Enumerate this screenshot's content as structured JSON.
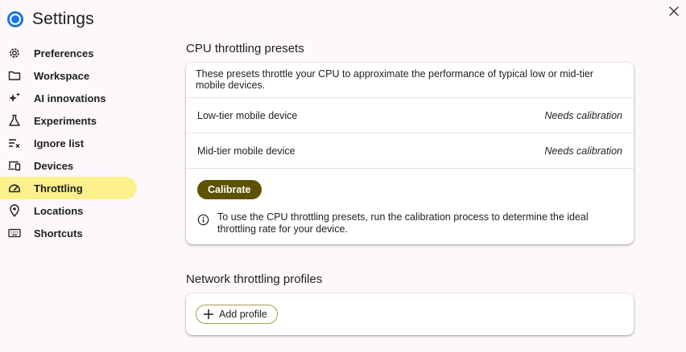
{
  "header": {
    "title": "Settings"
  },
  "sidebar": {
    "items": [
      {
        "label": "Preferences",
        "icon": "gear-icon"
      },
      {
        "label": "Workspace",
        "icon": "folder-icon"
      },
      {
        "label": "AI innovations",
        "icon": "sparkle-icon"
      },
      {
        "label": "Experiments",
        "icon": "flask-icon"
      },
      {
        "label": "Ignore list",
        "icon": "ignore-list-icon"
      },
      {
        "label": "Devices",
        "icon": "devices-icon"
      },
      {
        "label": "Throttling",
        "icon": "speedometer-icon",
        "active": true
      },
      {
        "label": "Locations",
        "icon": "location-pin-icon"
      },
      {
        "label": "Shortcuts",
        "icon": "keyboard-icon"
      }
    ]
  },
  "cpu": {
    "title": "CPU throttling presets",
    "description": "These presets throttle your CPU to approximate the performance of typical low or mid-tier mobile devices.",
    "rows": [
      {
        "label": "Low-tier mobile device",
        "status": "Needs calibration"
      },
      {
        "label": "Mid-tier mobile device",
        "status": "Needs calibration"
      }
    ],
    "calibrate_label": "Calibrate",
    "info_text": "To use the CPU throttling presets, run the calibration process to determine the ideal throttling rate for your device."
  },
  "network": {
    "title": "Network throttling profiles",
    "add_profile_label": "Add profile"
  },
  "colors": {
    "active_nav": "#fbf08c",
    "primary_button": "#5c5200",
    "logo_blue": "#1a73e8"
  }
}
